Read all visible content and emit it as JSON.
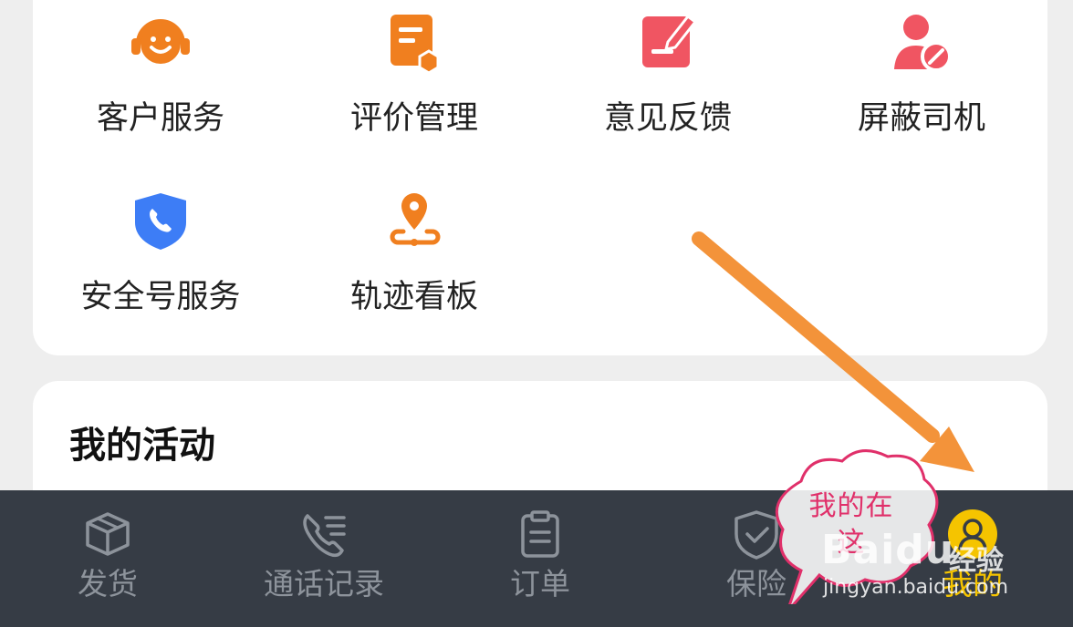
{
  "colors": {
    "accent_orange": "#f07f1f",
    "feedback_red": "#f05562",
    "shield_blue": "#3d7df6",
    "tabbar_bg": "#363c45",
    "tab_inactive": "#8d939b",
    "tab_active": "#f5c400",
    "annotation_arrow": "#f3933a",
    "annotation_text": "#e0306a"
  },
  "services": [
    {
      "label": "客户服务",
      "icon": "headset-smile-icon"
    },
    {
      "label": "评价管理",
      "icon": "document-badge-icon"
    },
    {
      "label": "意见反馈",
      "icon": "feedback-edit-icon"
    },
    {
      "label": "屏蔽司机",
      "icon": "person-block-icon"
    },
    {
      "label": "安全号服务",
      "icon": "phone-shield-icon"
    },
    {
      "label": "轨迹看板",
      "icon": "route-pin-icon"
    }
  ],
  "activity": {
    "title": "我的活动"
  },
  "tabbar": {
    "tabs": [
      {
        "label": "发货",
        "icon": "box-icon",
        "active": false
      },
      {
        "label": "通话记录",
        "icon": "phone-list-icon",
        "active": false
      },
      {
        "label": "订单",
        "icon": "clipboard-icon",
        "active": false
      },
      {
        "label": "保险",
        "icon": "shield-check-icon",
        "active": false
      },
      {
        "label": "我的",
        "icon": "user-icon",
        "active": true
      }
    ]
  },
  "annotation": {
    "bubble_text": "我的在这"
  },
  "watermark": {
    "brand": "Baidu",
    "sub": "经验",
    "url": "jingyan.baidu.com"
  }
}
